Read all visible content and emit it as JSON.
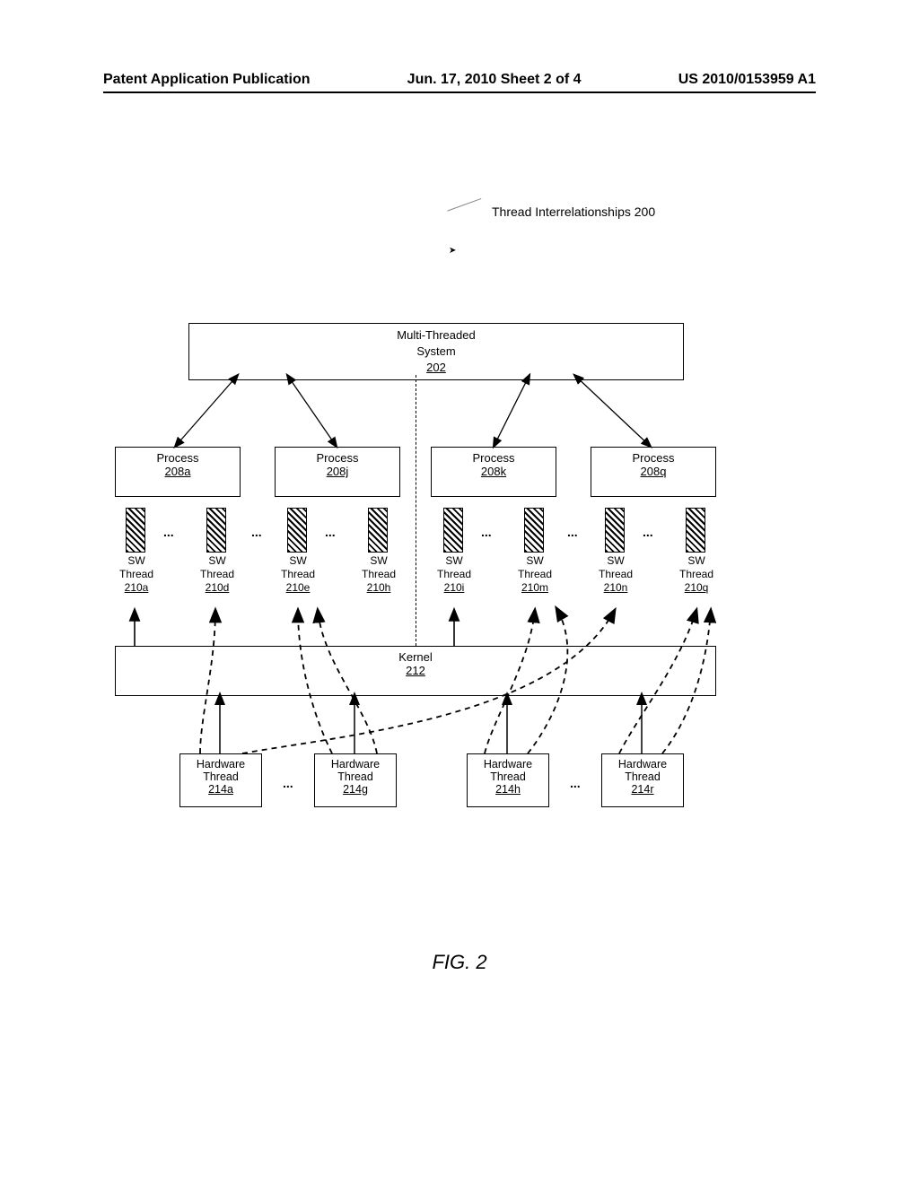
{
  "header": {
    "left": "Patent Application Publication",
    "center": "Jun. 17, 2010  Sheet 2 of 4",
    "right": "US 2010/0153959 A1"
  },
  "figure": {
    "titleLabel": "Thread Interrelationships 200",
    "mts": {
      "label": "Multi-Threaded\nSystem",
      "num": "202"
    },
    "processes": [
      {
        "label": "Process",
        "num": "208a"
      },
      {
        "label": "Process",
        "num": "208j"
      },
      {
        "label": "Process",
        "num": "208k"
      },
      {
        "label": "Process",
        "num": "208q"
      }
    ],
    "processEllipsis": "...",
    "swThreads": [
      {
        "label": "SW\nThread",
        "num": "210a"
      },
      {
        "label": "SW\nThread",
        "num": "210d"
      },
      {
        "label": "SW\nThread",
        "num": "210e"
      },
      {
        "label": "SW\nThread",
        "num": "210h"
      },
      {
        "label": "SW\nThread",
        "num": "210i"
      },
      {
        "label": "SW\nThread",
        "num": "210m"
      },
      {
        "label": "SW\nThread",
        "num": "210n"
      },
      {
        "label": "SW\nThread",
        "num": "210q"
      }
    ],
    "swEllipsis": "...",
    "kernel": {
      "label": "Kernel",
      "num": "212"
    },
    "hwThreads": [
      {
        "label": "Hardware\nThread",
        "num": "214a"
      },
      {
        "label": "Hardware\nThread",
        "num": "214g"
      },
      {
        "label": "Hardware\nThread",
        "num": "214h"
      },
      {
        "label": "Hardware\nThread",
        "num": "214r"
      }
    ],
    "hwEllipsis": "...",
    "caption": "FIG. 2"
  }
}
